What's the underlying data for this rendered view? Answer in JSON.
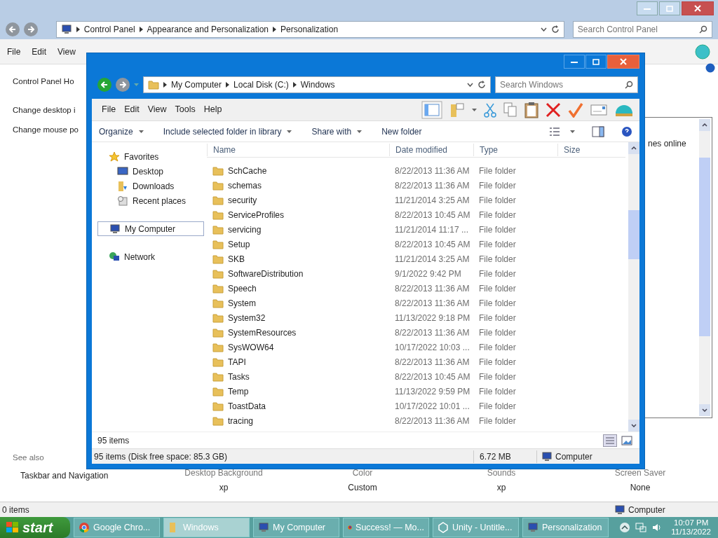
{
  "control_panel": {
    "breadcrumb": [
      "Control Panel",
      "Appearance and Personalization",
      "Personalization"
    ],
    "search": {
      "placeholder": "Search Control Panel"
    },
    "menu": [
      "File",
      "Edit",
      "View"
    ],
    "sidebar_links": [
      "Control Panel Ho",
      "Change desktop i",
      "Change mouse po"
    ],
    "right_link": "nes online",
    "see_also": {
      "heading": "See also",
      "links": [
        "Taskbar and Navigation"
      ]
    },
    "theme_settings": [
      {
        "label": "Desktop Background",
        "value": "xp"
      },
      {
        "label": "Color",
        "value": "Custom"
      },
      {
        "label": "Sounds",
        "value": "xp"
      },
      {
        "label": "Screen Saver",
        "value": "None"
      }
    ],
    "status": {
      "items": "0 items",
      "location": "Computer"
    }
  },
  "explorer": {
    "breadcrumb": [
      "My Computer",
      "Local Disk (C:)",
      "Windows"
    ],
    "search": {
      "placeholder": "Search Windows"
    },
    "menu": [
      "File",
      "Edit",
      "View",
      "Tools",
      "Help"
    ],
    "commands": [
      {
        "label": "Organize",
        "dropdown": true
      },
      {
        "label": "Include selected folder in library",
        "dropdown": true
      },
      {
        "label": "Share with",
        "dropdown": true
      },
      {
        "label": "New folder",
        "dropdown": false
      }
    ],
    "navigation": [
      {
        "label": "Favorites",
        "kind": "favorites",
        "selected": false,
        "children": [
          {
            "label": "Desktop",
            "kind": "desktop",
            "selected": false
          },
          {
            "label": "Downloads",
            "kind": "downloads",
            "selected": false
          },
          {
            "label": "Recent places",
            "kind": "recent",
            "selected": false
          }
        ]
      },
      {
        "label": "My Computer",
        "kind": "computer",
        "selected": true
      },
      {
        "label": "Network",
        "kind": "network",
        "selected": false
      }
    ],
    "columns": [
      "Name",
      "Date modified",
      "Type",
      "Size"
    ],
    "rows": [
      {
        "name": "SchCache",
        "date": "8/22/2013 11:36 AM",
        "type": "File folder"
      },
      {
        "name": "schemas",
        "date": "8/22/2013 11:36 AM",
        "type": "File folder"
      },
      {
        "name": "security",
        "date": "11/21/2014 3:25 AM",
        "type": "File folder"
      },
      {
        "name": "ServiceProfiles",
        "date": "8/22/2013 10:45 AM",
        "type": "File folder"
      },
      {
        "name": "servicing",
        "date": "11/21/2014 11:17 ...",
        "type": "File folder"
      },
      {
        "name": "Setup",
        "date": "8/22/2013 10:45 AM",
        "type": "File folder"
      },
      {
        "name": "SKB",
        "date": "11/21/2014 3:25 AM",
        "type": "File folder"
      },
      {
        "name": "SoftwareDistribution",
        "date": "9/1/2022 9:42 PM",
        "type": "File folder"
      },
      {
        "name": "Speech",
        "date": "8/22/2013 11:36 AM",
        "type": "File folder"
      },
      {
        "name": "System",
        "date": "8/22/2013 11:36 AM",
        "type": "File folder"
      },
      {
        "name": "System32",
        "date": "11/13/2022 9:18 PM",
        "type": "File folder"
      },
      {
        "name": "SystemResources",
        "date": "8/22/2013 11:36 AM",
        "type": "File folder"
      },
      {
        "name": "SysWOW64",
        "date": "10/17/2022 10:03 ...",
        "type": "File folder"
      },
      {
        "name": "TAPI",
        "date": "8/22/2013 11:36 AM",
        "type": "File folder"
      },
      {
        "name": "Tasks",
        "date": "8/22/2013 10:45 AM",
        "type": "File folder"
      },
      {
        "name": "Temp",
        "date": "11/13/2022 9:59 PM",
        "type": "File folder"
      },
      {
        "name": "ToastData",
        "date": "10/17/2022 10:01 ...",
        "type": "File folder"
      },
      {
        "name": "tracing",
        "date": "8/22/2013 11:36 AM",
        "type": "File folder"
      }
    ],
    "item_count": "95 items",
    "status": {
      "details": "95 items (Disk free space: 85.3 GB)",
      "size": "6.72 MB",
      "location": "Computer"
    }
  },
  "taskbar": {
    "start": "start",
    "buttons": [
      {
        "label": "Google Chro...",
        "kind": "chrome",
        "selected": false
      },
      {
        "label": "Windows",
        "kind": "folder",
        "selected": true
      },
      {
        "label": "My Computer",
        "kind": "computer",
        "selected": false
      },
      {
        "label": "Success! — Mo...",
        "kind": "firefox",
        "selected": false
      },
      {
        "label": "Unity - Untitle...",
        "kind": "unity",
        "selected": false
      },
      {
        "label": "Personalization",
        "kind": "panel",
        "selected": false
      }
    ],
    "clock": {
      "time": "10:07 PM",
      "date": "11/13/2022"
    }
  }
}
